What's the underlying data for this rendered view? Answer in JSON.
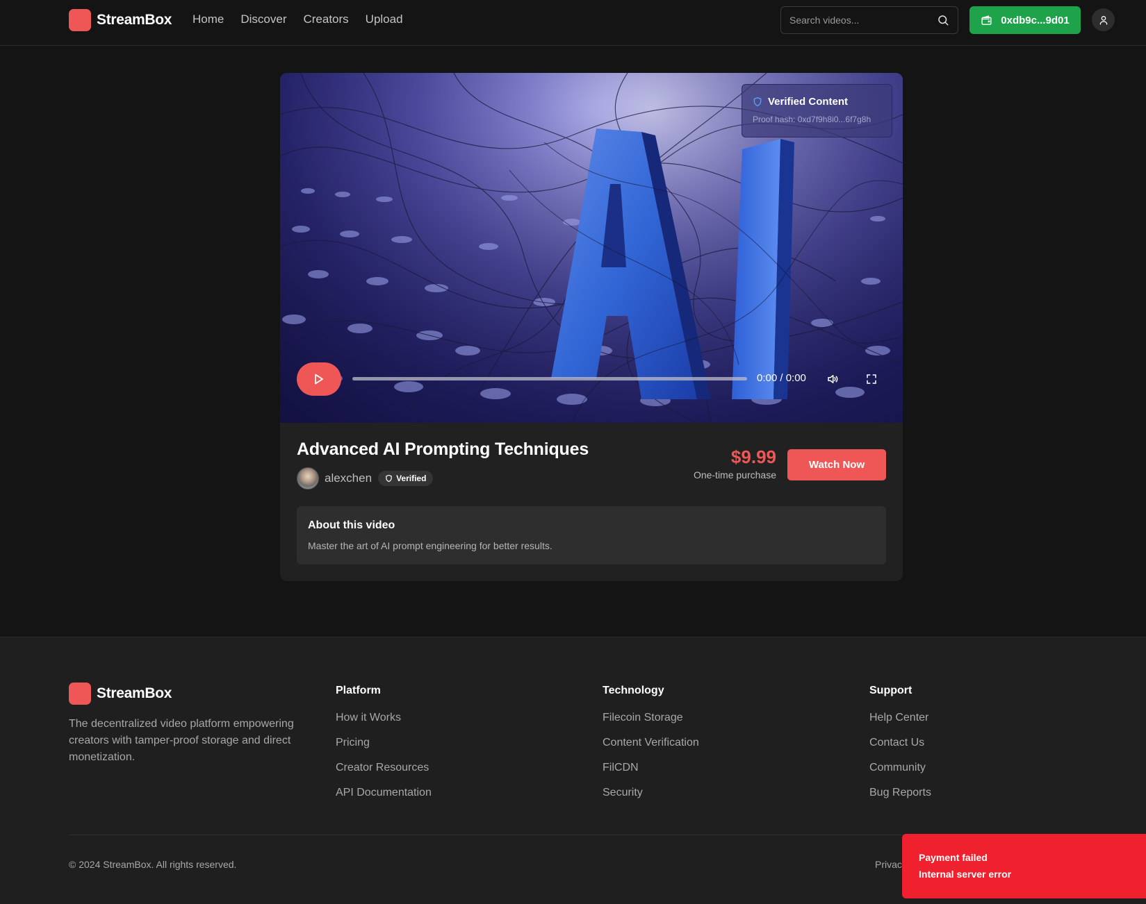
{
  "app": {
    "name": "StreamBox",
    "brand_color": "#ef5757"
  },
  "nav": {
    "items": [
      "Home",
      "Discover",
      "Creators",
      "Upload"
    ]
  },
  "search": {
    "placeholder": "Search videos..."
  },
  "wallet": {
    "label": "0xdb9c...9d01",
    "color": "#1fa34a"
  },
  "video": {
    "verified_title": "Verified Content",
    "proof_hash": "Proof hash: 0xd7f9h8i0...6f7g8h",
    "time": "0:00 / 0:00",
    "progress": 0,
    "thumbnail_text": "AI"
  },
  "details": {
    "title": "Advanced AI Prompting Techniques",
    "author": "alexchen",
    "badge": "Verified",
    "price": "$9.99",
    "price_note": "One-time purchase",
    "cta": "Watch Now",
    "about_title": "About this video",
    "about_text": "Master the art of AI prompt engineering for better results."
  },
  "footer": {
    "brand": "StreamBox",
    "description": "The decentralized video platform empowering creators with tamper-proof storage and direct monetization.",
    "columns": [
      {
        "title": "Platform",
        "links": [
          "How it Works",
          "Pricing",
          "Creator Resources",
          "API Documentation"
        ]
      },
      {
        "title": "Technology",
        "links": [
          "Filecoin Storage",
          "Content Verification",
          "FilCDN",
          "Security"
        ]
      },
      {
        "title": "Support",
        "links": [
          "Help Center",
          "Contact Us",
          "Community",
          "Bug Reports"
        ]
      }
    ],
    "copyright": "© 2024 StreamBox. All rights reserved.",
    "privacy_partial": "Privac"
  },
  "toast": {
    "title": "Payment failed",
    "message": "Internal server error",
    "color": "#f0212f"
  }
}
